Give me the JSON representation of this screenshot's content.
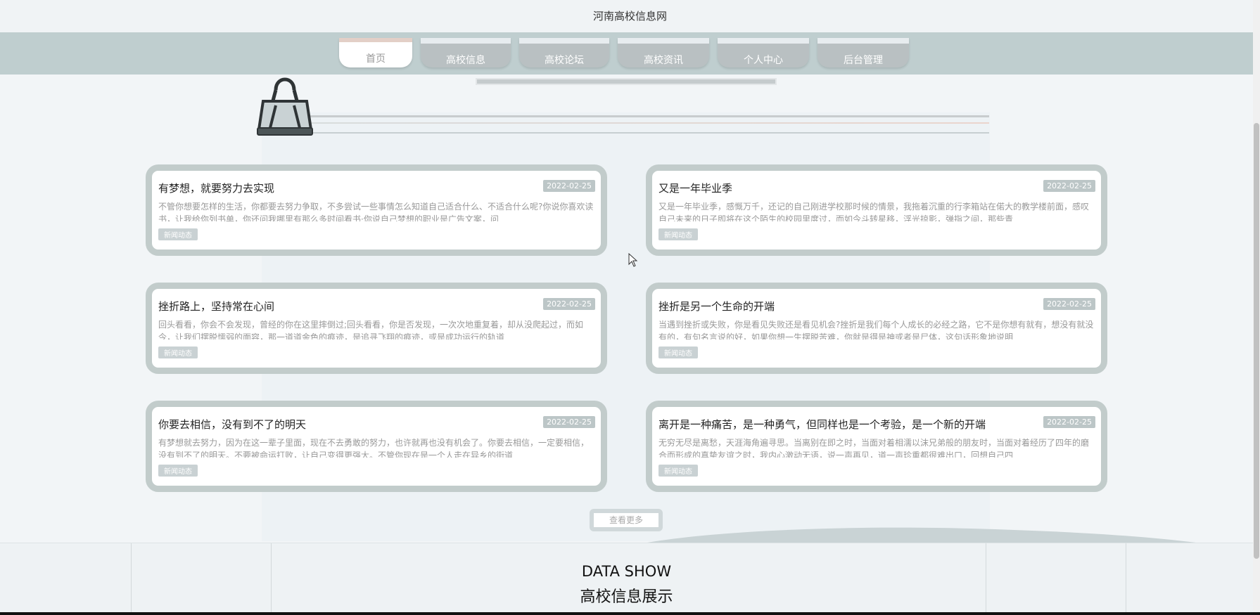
{
  "site": {
    "title": "河南高校信息网"
  },
  "nav": {
    "items": [
      {
        "label": "首页",
        "active": true
      },
      {
        "label": "高校信息",
        "active": false
      },
      {
        "label": "高校论坛",
        "active": false
      },
      {
        "label": "高校资讯",
        "active": false
      },
      {
        "label": "个人中心",
        "active": false
      },
      {
        "label": "后台管理",
        "active": false
      }
    ]
  },
  "news": [
    {
      "title": "有梦想，就要努力去实现",
      "date": "2022-02-25",
      "excerpt": "不管你想要怎样的生活，你都要去努力争取，不多尝试一些事情怎么知道自己适合什么、不适合什么呢?你说你喜欢读书，让我给你列书单，你还问我哪里有那么多时间看书·你说自己梦想的职业是广告文案，问",
      "tag": "新闻动态"
    },
    {
      "title": "又是一年毕业季",
      "date": "2022-02-25",
      "excerpt": "又是一年毕业季，感慨万千，还记的自己刚进学校那时候的情景，我拖着沉重的行李箱站在偌大的教学楼前面，感叹自己未来的日子即将在这个陌生的校园里度过，而如今斗转星移，浮光掠影，弹指之间，那些青",
      "tag": "新闻动态"
    },
    {
      "title": "挫折路上，坚持常在心间",
      "date": "2022-02-25",
      "excerpt": "回头看看，你会不会发现，曾经的你在这里摔倒过;回头看看，你是否发现，一次次地重复着，却从没爬起过，而如今，让我们摆脱懦弱的面容，那一道道金色的痕迹，是追寻飞翔的痕迹，或是成功运行的轨道",
      "tag": "新闻动态"
    },
    {
      "title": "挫折是另一个生命的开端",
      "date": "2022-02-25",
      "excerpt": "当遇到挫折或失败，你是看见失败还是看见机会?挫折是我们每个人成长的必经之路，它不是你想有就有，想没有就没有的，有句名言说的好，如果你想一生摆脱苦难，你就是得是神或者是尸体，这句话形象地说明",
      "tag": "新闻动态"
    },
    {
      "title": "你要去相信，没有到不了的明天",
      "date": "2022-02-25",
      "excerpt": "有梦想就去努力，因为在这一辈子里面，现在不去勇敢的努力，也许就再也没有机会了。你要去相信，一定要相信，没有到不了的明天。不要被命运打败，让自己变得更强大。不管你现在是一个人走在异乡的街道",
      "tag": "新闻动态"
    },
    {
      "title": "离开是一种痛苦，是一种勇气，但同样也是一个考验，是一个新的开端",
      "date": "2022-02-25",
      "excerpt": "无穷无尽是离愁，天涯海角遍寻思。当离别在即之时，当面对着相濡以沫兄弟般的朋友时，当面对着经历了四年的磨合而形成的真挚友谊之时，我内心激动无语，说一声再见，道一声珍重都很难出口，回想自己四",
      "tag": "新闻动态"
    }
  ],
  "more": {
    "label": "查看更多"
  },
  "data_show": {
    "en": "DATA SHOW",
    "cn": "高校信息展示"
  },
  "colors": {
    "nav_bg": "#bfcecf",
    "card_border": "#c2cccb",
    "date_badge": "#bcc6c7"
  }
}
